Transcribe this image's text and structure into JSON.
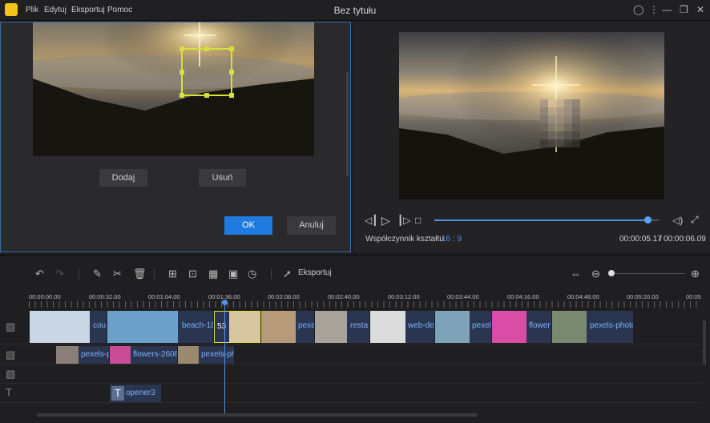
{
  "app": {
    "title": "Bez tytułu",
    "menu": [
      "Plik",
      "Edytuj",
      "Eksportuj",
      "Pomoc"
    ]
  },
  "editor": {
    "add_label": "Dodaj",
    "remove_label": "Usuń",
    "ok_label": "OK",
    "cancel_label": "Anuluj"
  },
  "preview": {
    "aspect_label": "Współczynnik kształtu",
    "aspect_value": "16 : 9",
    "time_current": "00:00:05.17",
    "time_separator": "/",
    "time_total": "00:00:06.09",
    "progress": 0.95
  },
  "toolbar": {
    "export_label": "Eksportuj"
  },
  "ruler": {
    "ticks": [
      "00:00:00.00",
      "00:00:32.00",
      "00:01:04.00",
      "00:01:36.00",
      "00:02:08.00",
      "00:02:40.00",
      "00:03:12.00",
      "00:03:44.00",
      "00:04:16.00",
      "00:04:48.00",
      "00:05:20.00",
      "00:05"
    ]
  },
  "tracks": {
    "video": [
      {
        "label": "cou",
        "color": "#c9d6e3"
      },
      {
        "label": "beach-18",
        "color": "#6aa0c9"
      },
      {
        "label": "53",
        "color": "#d8c6a0"
      },
      {
        "label": "pexe",
        "color": "#b79a7a"
      },
      {
        "label": "resta",
        "color": "#a8a29a"
      },
      {
        "label": "web-de",
        "color": "#dcdcdc"
      },
      {
        "label": "pexel",
        "color": "#7ea3b8"
      },
      {
        "label": "flower",
        "color": "#d94da6"
      },
      {
        "label": "pexels-photo",
        "color": "#7a8a70"
      }
    ],
    "overlay": [
      {
        "label": "pexels-p",
        "color": "#8a7f76"
      },
      {
        "label": "flowers-2608",
        "color": "#c94d95"
      },
      {
        "label": "pexels-ph",
        "color": "#9a8a70"
      }
    ],
    "text": [
      {
        "label": "opener3",
        "icon": "T"
      }
    ]
  },
  "colors": {
    "accent": "#1f7be0",
    "selection": "#d8e03a",
    "clip_bg": "#2a3550"
  }
}
